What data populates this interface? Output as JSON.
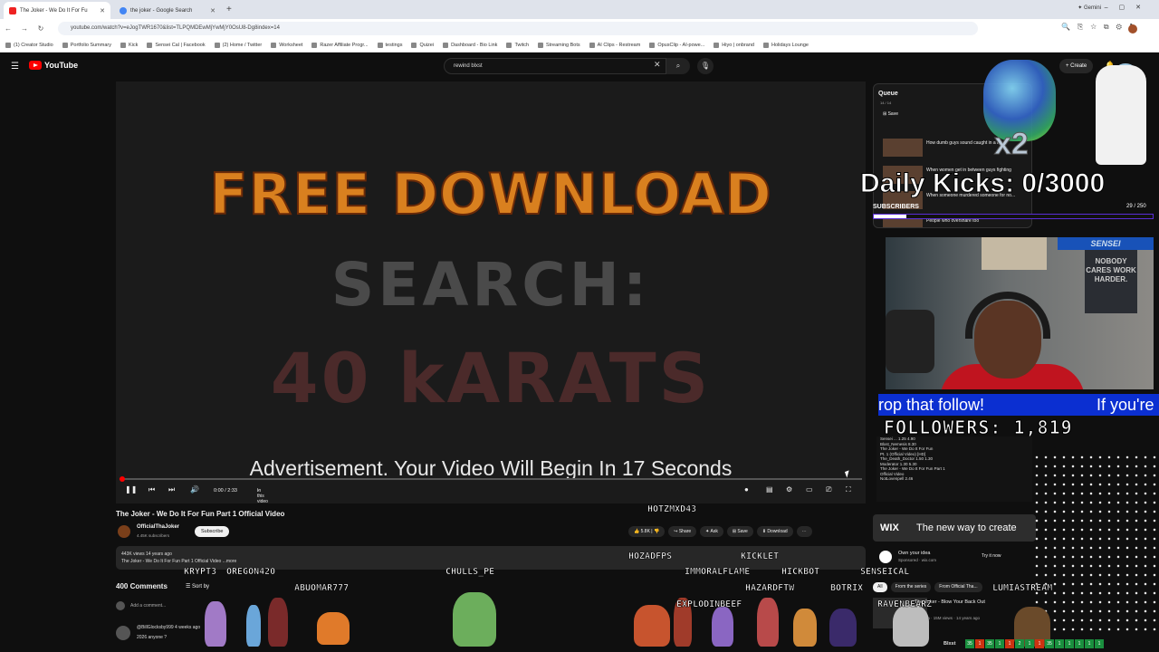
{
  "browser": {
    "tabs": [
      {
        "label": "The Joker - We Do It For Fu",
        "active": true
      },
      {
        "label": "the joker - Google Search",
        "active": false
      }
    ],
    "gemini_label": "Gemini",
    "url": "youtube.com/watch?v=eJogTWR1670&list=TLPQMDEwMjYwMjY0OsU8-Dg8index=14",
    "bookmarks": [
      "(1) Creator Studio",
      "Portfolio Summary",
      "Kick",
      "Sensei Cal | Facebook",
      "(2) Home / Twitter",
      "Worksheet",
      "Razer Affiliate Progr...",
      "testings",
      "Quizei",
      "Dashboard - Bio Link",
      "Twitch",
      "Streaming Bots",
      "AI Clips - Restream",
      "OpusClip - AI-powe...",
      "Hiyo | onbrand",
      "Holidays Lounge"
    ]
  },
  "youtube": {
    "logo_text": "YouTube",
    "search_value": "rewind blxst",
    "create_label": "+ Create"
  },
  "video": {
    "line1": "FREE DOWNLOAD",
    "line2": "SEARCH:",
    "line3": "40 kARATS",
    "ad_text": "Advertisement.  Your Video Will Begin In 17 Seconds",
    "time": "0:00 / 2:33",
    "chapter": "In this video",
    "title": "The Joker - We Do It For Fun Part 1 Official Video",
    "channel": "OfficialThaJoker",
    "subscribers": "4.45K subscribers",
    "subscribe_label": "Subscribe",
    "likes": "5.8K",
    "share_label": "Share",
    "ask_label": "Ask",
    "save_label": "Save",
    "download_label": "Download",
    "desc_line1": "443K views  14 years ago",
    "desc_line2": "The Joker - We Do It For Fun Part 1 Official Video ...more",
    "comments_count": "400 Comments",
    "sort_label": "Sort by",
    "add_comment": "Add a comment...",
    "comment_user": "@BillGlocksby999  4 weeks ago",
    "comment_text": "2026 anyone ?"
  },
  "queue": {
    "title": "Queue",
    "count": "14 / 14",
    "save": "Save",
    "items": [
      "How dumb guys sound caught in a lie",
      "When women get in between guys fighting",
      "When someone murdered someone for no...",
      "People who overshare too"
    ]
  },
  "overlay": {
    "daily_kicks": "Daily Kicks: 0/3000",
    "x2": "x2",
    "subs_label": "SUBSCRIBERS",
    "subs_count": "29  / 250",
    "subs_progress": 0.116,
    "follow_a": "rop that follow!",
    "follow_b": "If you're",
    "followers": "FOLLOWERS: 1,819",
    "sign_text": "NOBODY CARES WORK HARDER.",
    "banner_text": "SENSEI",
    "chat_names": [
      "HOTZMXD43",
      "HOZADFPS",
      "KICKLET",
      "KRYPT3",
      "OREGON420",
      "CHULLS_PE",
      "IMMORALFLAME",
      "HICKBOT",
      "SENSEICAL",
      "ABUOMAR777",
      "HAZARDFTW",
      "BOTRIX",
      "LUMIASTREAM",
      "EXPLODINBEEF",
      "RAVENBEARZ"
    ],
    "footer_label": "Blxst"
  },
  "sidebar": {
    "wix_logo": "WIX",
    "wix_tagline": "The new way to create",
    "sponsor_title": "Own your idea",
    "sponsor_sub": "Sponsored · wix.com",
    "try_label": "Try it now",
    "chips": [
      "All",
      "From the series",
      "From Official Tha..."
    ],
    "rec_title": "The Joker - Blow Your Back Out",
    "rec_sub": "hallboyh · 15M views · 14 years ago"
  }
}
